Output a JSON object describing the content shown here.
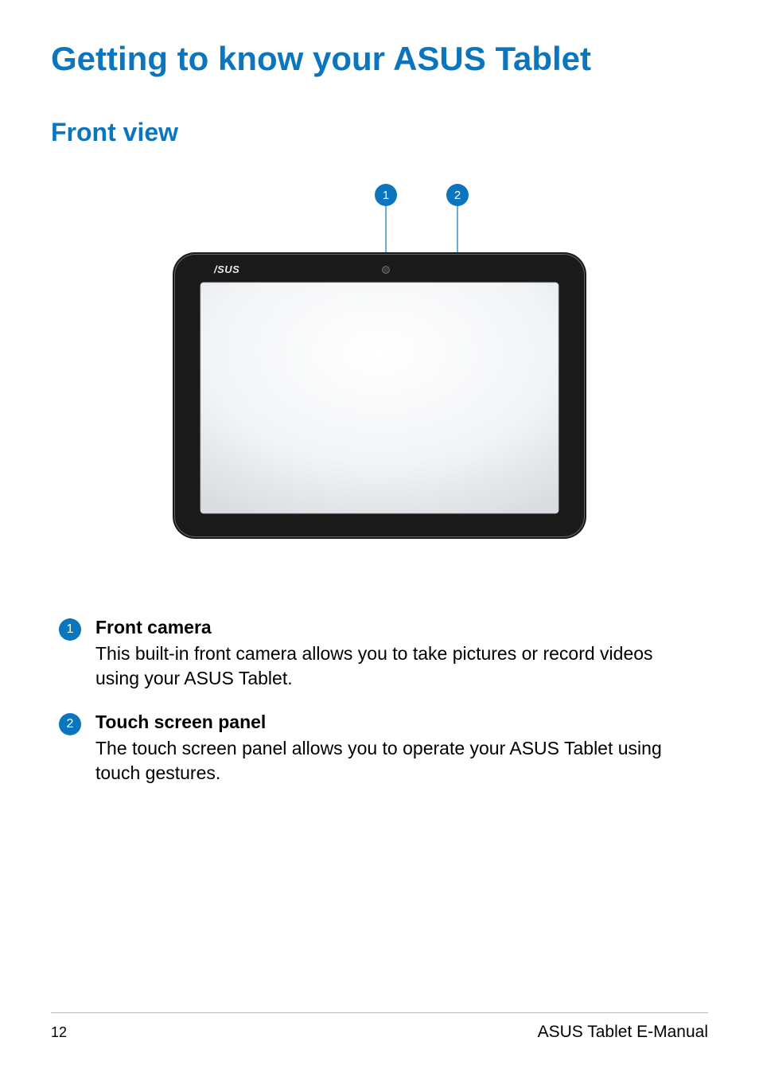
{
  "headings": {
    "h1": "Getting to know your ASUS Tablet",
    "h2": "Front view"
  },
  "diagram": {
    "brand_logo_text": "/SUS",
    "callout_labels": {
      "marker1": "1",
      "marker2": "2"
    }
  },
  "callouts": [
    {
      "num": "1",
      "title": "Front camera",
      "text": "This built-in front camera allows you to take pictures or record videos using your ASUS Tablet."
    },
    {
      "num": "2",
      "title": "Touch screen panel",
      "text": "The touch screen panel allows you to operate your ASUS Tablet using touch gestures."
    }
  ],
  "footer": {
    "page_number": "12",
    "manual_name": "ASUS Tablet E-Manual"
  },
  "colors": {
    "heading_blue": "#0b76bd",
    "bullet_blue": "#0b76bd"
  }
}
